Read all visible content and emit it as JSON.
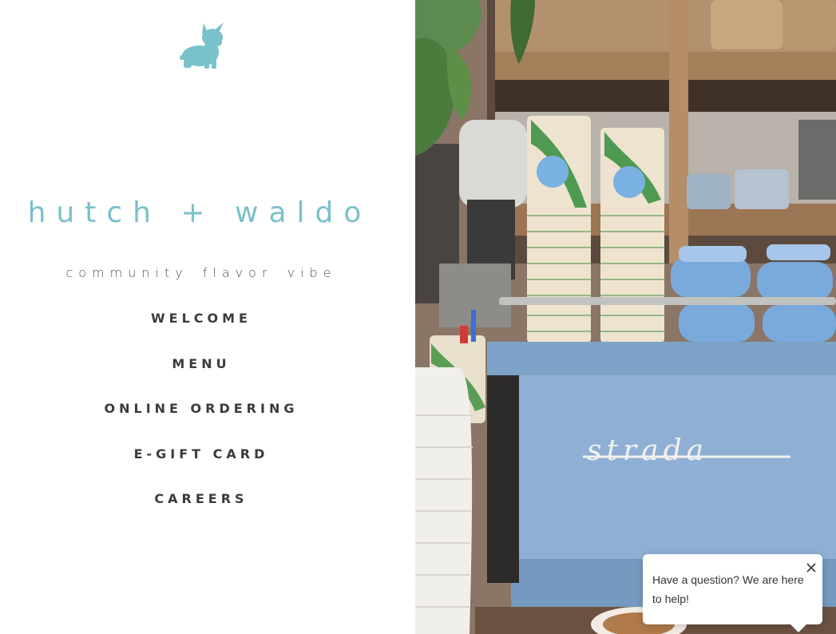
{
  "brand": {
    "name": "hutch + waldo",
    "tagline": "community flavor  vibe",
    "logo_icon": "french-bulldog-icon",
    "accent_color": "#79c1cb"
  },
  "nav": {
    "items": [
      {
        "label": "WELCOME"
      },
      {
        "label": "MENU"
      },
      {
        "label": "ONLINE ORDERING"
      },
      {
        "label": "E-GIFT CARD"
      },
      {
        "label": "CAREERS"
      }
    ]
  },
  "hero_photo": {
    "machine_label": "strada",
    "machine_color": "#8fb0d4"
  },
  "chat": {
    "message": "Have a question? We are here to help!",
    "close_icon": "close-icon"
  }
}
